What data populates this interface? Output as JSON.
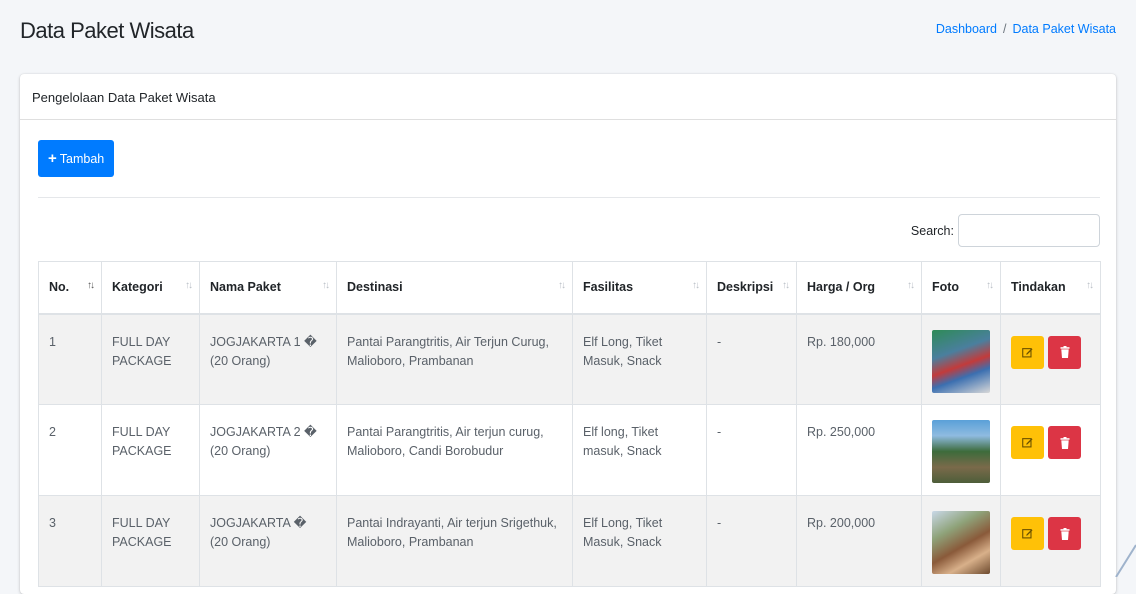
{
  "header": {
    "title": "Data Paket Wisata",
    "breadcrumb": {
      "home": "Dashboard",
      "separator": "/",
      "current": "Data Paket Wisata"
    }
  },
  "card": {
    "title": "Pengelolaan Data Paket Wisata",
    "add_button_label": "Tambah",
    "search_label": "Search:",
    "search_value": ""
  },
  "table": {
    "columns": [
      "No.",
      "Kategori",
      "Nama Paket",
      "Destinasi",
      "Fasilitas",
      "Deskripsi",
      "Harga / Org",
      "Foto",
      "Tindakan"
    ],
    "rows": [
      {
        "no": "1",
        "kategori": "FULL DAY PACKAGE",
        "nama_paket": "JOGJAKARTA 1 � (20 Orang)",
        "destinasi": "Pantai Parangtritis, Air Terjun Curug, Malioboro, Prambanan",
        "fasilitas": "Elf Long, Tiket Masuk, Snack",
        "deskripsi": "-",
        "harga": "Rp. 180,000"
      },
      {
        "no": "2",
        "kategori": "FULL DAY PACKAGE",
        "nama_paket": "JOGJAKARTA 2 � (20 Orang)",
        "destinasi": "Pantai Parangtritis, Air terjun curug, Malioboro, Candi Borobudur",
        "fasilitas": "Elf long, Tiket masuk, Snack",
        "deskripsi": "-",
        "harga": "Rp. 250,000"
      },
      {
        "no": "3",
        "kategori": "FULL DAY PACKAGE",
        "nama_paket": "JOGJAKARTA � (20 Orang)",
        "destinasi": "Pantai Indrayanti, Air terjun Srigethuk, Malioboro, Prambanan",
        "fasilitas": "Elf Long, Tiket Masuk, Snack",
        "deskripsi": "-",
        "harga": "Rp. 200,000"
      }
    ]
  },
  "colors": {
    "primary": "#007bff",
    "warning": "#ffc107",
    "danger": "#dc3545",
    "background": "#f4f6f9"
  },
  "icons": {
    "add": "plus-icon",
    "sort": "sort-icon",
    "edit": "edit-icon",
    "delete": "trash-icon"
  }
}
